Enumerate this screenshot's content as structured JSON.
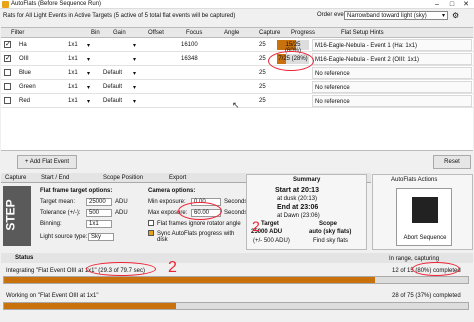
{
  "window": {
    "title": "AutoFlats (Before Sequence Run)",
    "minimize": "–",
    "maximize": "□",
    "close": "✕"
  },
  "header": {
    "rats_text": "Rats for All Light Events in Active Targets (5 active of 5 total flat events will be captured)",
    "order_label": "Order events by:",
    "order_value": "Narrowband toward light (sky)"
  },
  "grid": {
    "columns": [
      "Filter",
      "Bin",
      "Gain",
      "Offset",
      "Focus",
      "Angle",
      "Capture",
      "Progress",
      "Flat Setup Hints"
    ],
    "rows": [
      {
        "checked": true,
        "filter": "Ha",
        "bin": "1x1",
        "gain": "",
        "offset": "",
        "focus": "16100",
        "angle": "",
        "capture": "25",
        "progress_text": "15/25 (60%)",
        "progress": 0.6,
        "hint": "M16-Eagle-Nebula - Event 1 (Ha: 1x1)"
      },
      {
        "checked": true,
        "filter": "OIII",
        "bin": "1x1",
        "gain": "",
        "offset": "",
        "focus": "16348",
        "angle": "",
        "capture": "25",
        "progress_text": "7/25 (28%)",
        "progress": 0.28,
        "hint": "M16-Eagle-Nebula - Event 2 (OIII: 1x1)"
      },
      {
        "checked": false,
        "filter": "Blue",
        "bin": "1x1",
        "gain": "Default",
        "offset": "",
        "focus": "",
        "angle": "",
        "capture": "25",
        "progress_text": "",
        "progress": 0,
        "hint": "No reference"
      },
      {
        "checked": false,
        "filter": "Green",
        "bin": "1x1",
        "gain": "Default",
        "offset": "",
        "focus": "",
        "angle": "",
        "capture": "25",
        "progress_text": "",
        "progress": 0,
        "hint": "No reference"
      },
      {
        "checked": false,
        "filter": "Red",
        "bin": "1x1",
        "gain": "Default",
        "offset": "",
        "focus": "",
        "angle": "",
        "capture": "25",
        "progress_text": "",
        "progress": 0,
        "hint": "No reference"
      }
    ]
  },
  "add": {
    "add_label": "+ Add Flat Event",
    "reset_label": "Reset"
  },
  "tabs": {
    "capture": "Capture",
    "start": "Start / End",
    "scope": "Scope Position",
    "export": "Export"
  },
  "step": "STEP",
  "flat": {
    "title": "Flat frame target options:",
    "mean_label": "Target mean:",
    "mean_value": "25000",
    "mean_unit": "ADU",
    "tol_label": "Tolerance (+/-):",
    "tol_value": "500",
    "tol_unit": "ADU",
    "bin_label": "Binning:",
    "bin_value": "1x1",
    "ls_label": "Light source type:",
    "ls_value": "Sky"
  },
  "cam": {
    "title": "Camera options:",
    "min_label": "Min exposure:",
    "min_value": "0.00",
    "max_label": "Max exposure:",
    "max_value": "60.00",
    "unit": "Seconds",
    "opt1": "Flat frames ignore rotator angle",
    "opt2": "Sync AutoFlats progress with disk"
  },
  "summary": {
    "title": "Summary",
    "start": "Start at 20:13",
    "start_sub": "at dusk (20:13)",
    "end": "End at 23:06",
    "end_sub": "at Dawn (23:06)",
    "target_hdr": "Target",
    "target_val": "25000 ADU",
    "target_sub": "(+/- 500 ADU)",
    "scope_hdr": "Scope",
    "scope_val": "auto (sky flats)",
    "scope_sub": "Find sky flats"
  },
  "autoflats": {
    "title": "AutoFlats Actions",
    "abort": "Abort Sequence"
  },
  "status": {
    "title": "Status",
    "in_range": "In range, capturing",
    "line1": "Integrating \"Flat Event OIII at 1x1\" (29.3 of 79.7 sec)",
    "line1_right": "12 of 15 (80%) completed",
    "p1": 0.8,
    "line2": "Working on \"Flat Event OIII at 1x1\"",
    "line2_right": "28 of 75 (37%) completed",
    "p2": 0.37
  },
  "colors": {
    "accent": "#c8710d",
    "annot": "#e22233"
  }
}
